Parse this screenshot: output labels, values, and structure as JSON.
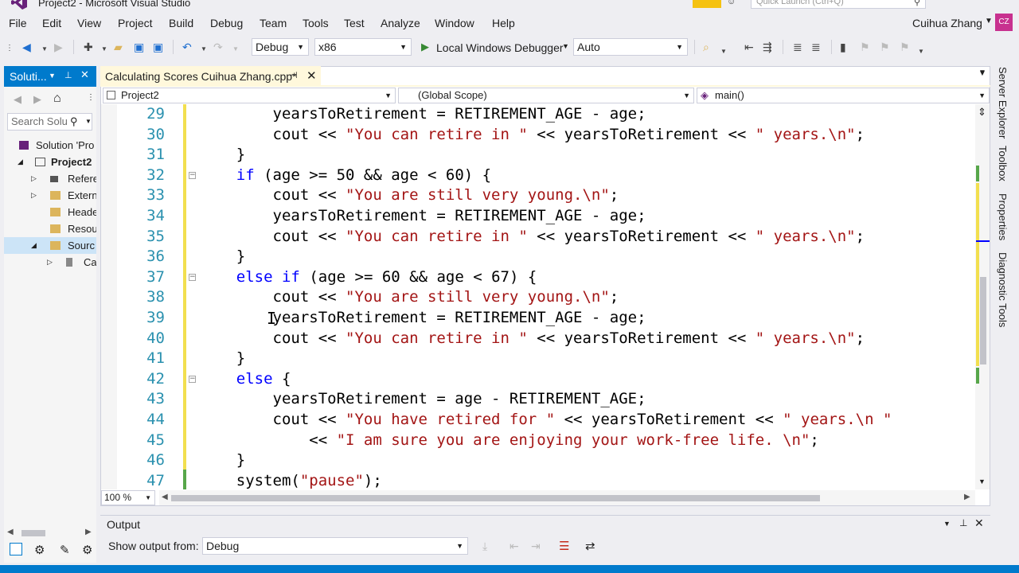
{
  "window": {
    "title": "Project2 - Microsoft Visual Studio",
    "quick_launch_placeholder": "Quick Launch (Ctrl+Q)"
  },
  "menu": [
    "File",
    "Edit",
    "View",
    "Project",
    "Build",
    "Debug",
    "Team",
    "Tools",
    "Test",
    "Analyze",
    "Window",
    "Help"
  ],
  "user": {
    "name": "Cuihua Zhang",
    "initials": "CZ",
    "avatar_color": "#c8318f"
  },
  "toolbar": {
    "configuration": "Debug",
    "platform": "x86",
    "run_label": "Local Windows Debugger",
    "stack_frame": "Auto"
  },
  "solution_explorer": {
    "title": "Soluti...",
    "search_placeholder": "Search Solu",
    "tree": [
      {
        "label": "Solution 'Pro",
        "icon": "solution-icon"
      },
      {
        "label": "Project2",
        "icon": "project-icon",
        "bold": true
      },
      {
        "label": "Refere",
        "icon": "references-icon"
      },
      {
        "label": "Extern",
        "icon": "external-deps-icon"
      },
      {
        "label": "Heade",
        "icon": "folder-icon"
      },
      {
        "label": "Resou",
        "icon": "folder-icon"
      },
      {
        "label": "Sourc",
        "icon": "folder-icon",
        "selected": true
      },
      {
        "label": "Ca",
        "icon": "cpp-file-icon"
      }
    ]
  },
  "editor": {
    "tab_title": "Calculating Scores Cuihua Zhang.cpp*",
    "nav_project": "Project2",
    "nav_scope": "(Global Scope)",
    "nav_member": "main()",
    "zoom": "100 %",
    "lines": [
      {
        "n": "29",
        "text": "        yearsToRetirement = RETIREMENT_AGE - age;"
      },
      {
        "n": "30",
        "text": "        cout << \"You can retire in \" << yearsToRetirement << \" years.\\n\";"
      },
      {
        "n": "31",
        "text": "    }"
      },
      {
        "n": "32",
        "text": "    if (age >= 50 && age < 60) {"
      },
      {
        "n": "33",
        "text": "        cout << \"You are still very young.\\n\";"
      },
      {
        "n": "34",
        "text": "        yearsToRetirement = RETIREMENT_AGE - age;"
      },
      {
        "n": "35",
        "text": "        cout << \"You can retire in \" << yearsToRetirement << \" years.\\n\";"
      },
      {
        "n": "36",
        "text": "    }"
      },
      {
        "n": "37",
        "text": "    else if (age >= 60 && age < 67) {"
      },
      {
        "n": "38",
        "text": "        cout << \"You are still very young.\\n\";"
      },
      {
        "n": "39",
        "text": "        yearsToRetirement = RETIREMENT_AGE - age;"
      },
      {
        "n": "40",
        "text": "        cout << \"You can retire in \" << yearsToRetirement << \" years.\\n\";"
      },
      {
        "n": "41",
        "text": "    }"
      },
      {
        "n": "42",
        "text": "    else {"
      },
      {
        "n": "43",
        "text": "        yearsToRetirement = age - RETIREMENT_AGE;"
      },
      {
        "n": "44",
        "text": "        cout << \"You have retired for \" << yearsToRetirement << \" years.\\n \""
      },
      {
        "n": "45",
        "text": "            << \"I am sure you are enjoying your work-free life. \\n\";"
      },
      {
        "n": "46",
        "text": "    }"
      },
      {
        "n": "47",
        "text": "    system(\"pause\");"
      }
    ]
  },
  "output": {
    "title": "Output",
    "show_from_label": "Show output from:",
    "source": "Debug"
  },
  "right_tabs": [
    "Server Explorer",
    "Toolbox",
    "Properties",
    "Diagnostic Tools"
  ],
  "colors": {
    "accent": "#007acc",
    "keyword": "#0000ff",
    "string": "#a31515",
    "line_number": "#2b91af"
  }
}
